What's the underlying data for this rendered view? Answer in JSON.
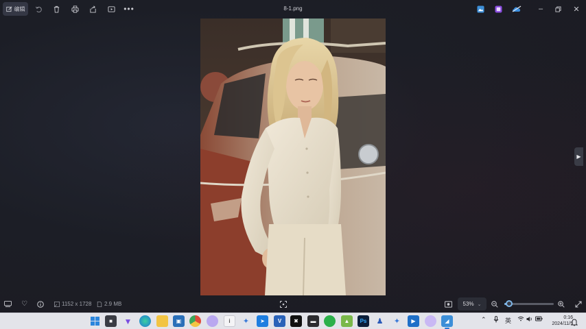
{
  "window": {
    "title": "8-1.png",
    "edit_label": "编辑"
  },
  "toolbar_icons": [
    "edit-icon",
    "rotate-icon",
    "delete-icon",
    "print-icon",
    "share-icon",
    "slideshow-icon",
    "more-icon"
  ],
  "title_right_icons": [
    "photos-edit-app-icon",
    "clipchamp-icon",
    "onedrive-icon"
  ],
  "info": {
    "dimensions": "1152 x 1728",
    "file_size": "2.9 MB"
  },
  "zoom": {
    "label": "53%",
    "level": 0.1
  },
  "tray": {
    "ime": "英",
    "time": "0:16",
    "date": "2024/11/5"
  },
  "colors": {
    "accent": "#7fb7e8",
    "taskbar_bg": "#e3e4ea",
    "viewer_bg": "#1b1d24"
  }
}
